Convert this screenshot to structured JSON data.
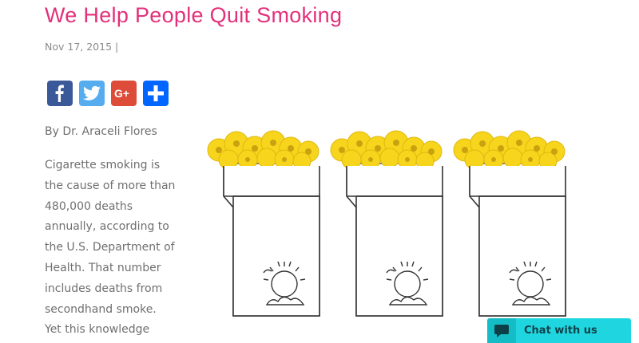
{
  "post": {
    "title": "We Help People Quit Smoking",
    "date_line": "Nov 17, 2015 |",
    "byline": "By Dr. Araceli Flores",
    "body_lines": [
      "Cigarette smoking is",
      "the cause of more than",
      "480,000 deaths",
      "annually, according to",
      "the U.S. Department of",
      "Health. That number",
      "includes deaths from",
      "secondhand smoke.",
      "Yet this knowledge"
    ]
  },
  "share": {
    "buttons": [
      {
        "icon": "facebook-icon",
        "color": "#3b5998"
      },
      {
        "icon": "twitter-icon",
        "color": "#55acee"
      },
      {
        "icon": "google-plus-icon",
        "color": "#dd4b39"
      },
      {
        "icon": "share-plus-icon",
        "color": "#0166ff"
      }
    ]
  },
  "illustration": {
    "description_icon": "cigarette-packs-with-flowers",
    "colors": {
      "flower": "#f7d51d",
      "flower_center": "#c9a20f",
      "line": "#333333"
    }
  },
  "chat": {
    "label": "Chat with us",
    "color": "#1fd6e0",
    "icon": "speech-bubble-icon"
  }
}
